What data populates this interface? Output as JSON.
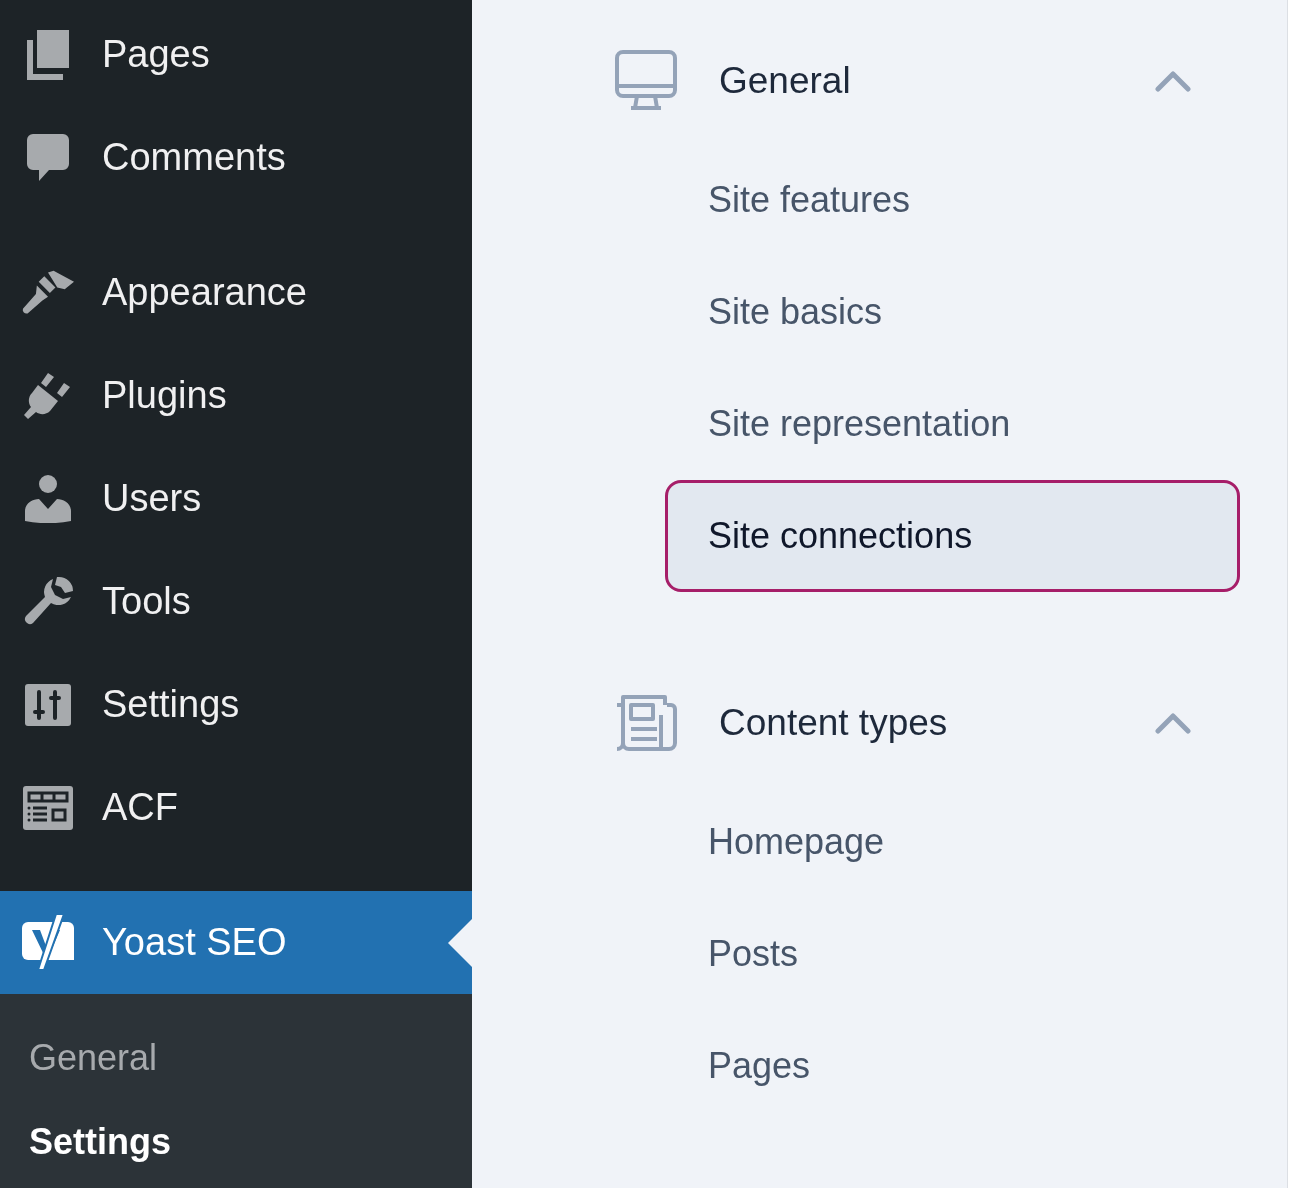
{
  "admin_menu": {
    "sections": [
      {
        "items": [
          {
            "label": "Pages",
            "selected": false
          },
          {
            "label": "Comments",
            "selected": false
          }
        ]
      },
      {
        "items": [
          {
            "label": "Appearance",
            "selected": false
          },
          {
            "label": "Plugins",
            "selected": false
          },
          {
            "label": "Users",
            "selected": false
          },
          {
            "label": "Tools",
            "selected": false
          },
          {
            "label": "Settings",
            "selected": false
          },
          {
            "label": "ACF",
            "selected": false
          }
        ]
      },
      {
        "items": [
          {
            "label": "Yoast SEO",
            "selected": true,
            "submenu": [
              {
                "label": "General",
                "selected": false
              },
              {
                "label": "Settings",
                "selected": true
              }
            ]
          }
        ]
      }
    ]
  },
  "settings_nav": {
    "groups": [
      {
        "title": "General",
        "expanded": true,
        "items": [
          {
            "label": "Site features",
            "selected": false
          },
          {
            "label": "Site basics",
            "selected": false
          },
          {
            "label": "Site representation",
            "selected": false
          },
          {
            "label": "Site connections",
            "selected": true
          }
        ]
      },
      {
        "title": "Content types",
        "expanded": true,
        "items": [
          {
            "label": "Homepage",
            "selected": false
          },
          {
            "label": "Posts",
            "selected": false
          },
          {
            "label": "Pages",
            "selected": false
          }
        ]
      }
    ]
  }
}
